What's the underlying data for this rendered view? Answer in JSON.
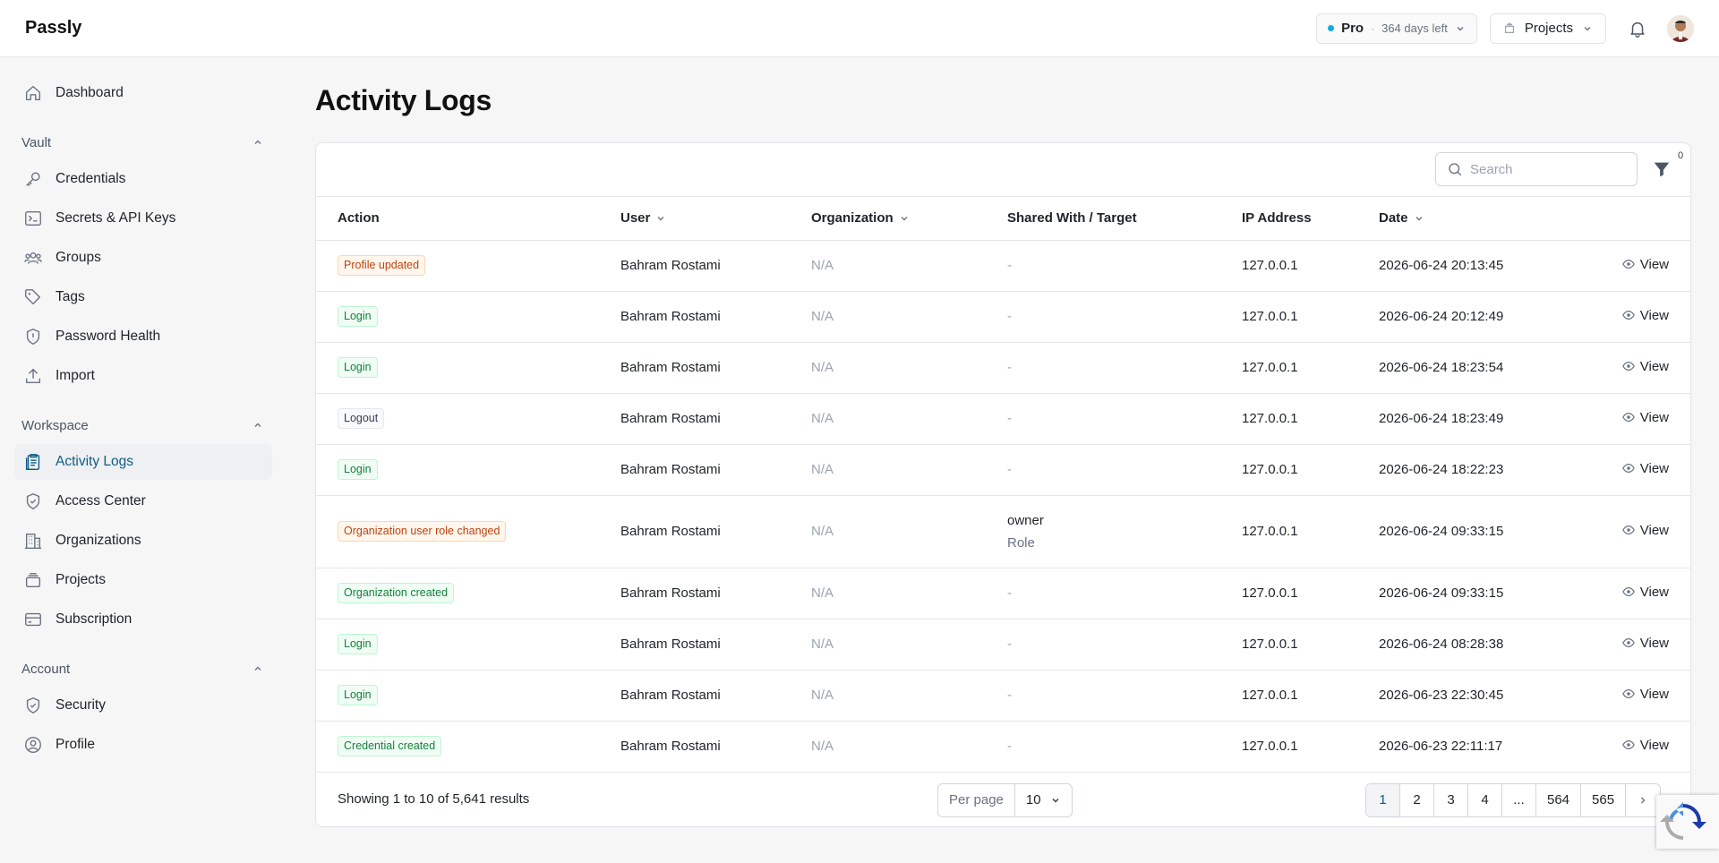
{
  "app": {
    "brand": "Passly"
  },
  "header": {
    "plan_name": "Pro",
    "plan_days": "364 days left",
    "projects_label": "Projects"
  },
  "sidebar": {
    "top_items": [
      {
        "label": "Dashboard",
        "icon": "home-icon"
      }
    ],
    "sections": [
      {
        "title": "Vault",
        "items": [
          {
            "label": "Credentials",
            "icon": "key-icon"
          },
          {
            "label": "Secrets & API Keys",
            "icon": "terminal-icon"
          },
          {
            "label": "Groups",
            "icon": "users-icon"
          },
          {
            "label": "Tags",
            "icon": "tag-icon"
          },
          {
            "label": "Password Health",
            "icon": "shield-alert-icon"
          },
          {
            "label": "Import",
            "icon": "upload-icon"
          }
        ]
      },
      {
        "title": "Workspace",
        "items": [
          {
            "label": "Activity Logs",
            "icon": "clipboard-icon"
          },
          {
            "label": "Access Center",
            "icon": "shield-check-icon"
          },
          {
            "label": "Organizations",
            "icon": "building-icon"
          },
          {
            "label": "Projects",
            "icon": "layers-icon"
          },
          {
            "label": "Subscription",
            "icon": "credit-card-icon"
          }
        ]
      },
      {
        "title": "Account",
        "items": [
          {
            "label": "Security",
            "icon": "shield-check-icon"
          },
          {
            "label": "Profile",
            "icon": "user-circle-icon"
          }
        ]
      }
    ]
  },
  "page": {
    "title": "Activity Logs"
  },
  "toolbar": {
    "search_placeholder": "Search",
    "filter_count": "0"
  },
  "table": {
    "columns": [
      "Action",
      "User",
      "Organization",
      "Shared With / Target",
      "IP Address",
      "Date"
    ],
    "view_label": "View",
    "rows": [
      {
        "action": "Profile updated",
        "tone": "orange",
        "user": "Bahram Rostami",
        "org": "N/A",
        "shared": "-",
        "shared_sub": "",
        "ip": "127.0.0.1",
        "date": "2026-06-24 20:13:45"
      },
      {
        "action": "Login",
        "tone": "green",
        "user": "Bahram Rostami",
        "org": "N/A",
        "shared": "-",
        "shared_sub": "",
        "ip": "127.0.0.1",
        "date": "2026-06-24 20:12:49"
      },
      {
        "action": "Login",
        "tone": "green",
        "user": "Bahram Rostami",
        "org": "N/A",
        "shared": "-",
        "shared_sub": "",
        "ip": "127.0.0.1",
        "date": "2026-06-24 18:23:54"
      },
      {
        "action": "Logout",
        "tone": "gray",
        "user": "Bahram Rostami",
        "org": "N/A",
        "shared": "-",
        "shared_sub": "",
        "ip": "127.0.0.1",
        "date": "2026-06-24 18:23:49"
      },
      {
        "action": "Login",
        "tone": "green",
        "user": "Bahram Rostami",
        "org": "N/A",
        "shared": "-",
        "shared_sub": "",
        "ip": "127.0.0.1",
        "date": "2026-06-24 18:22:23"
      },
      {
        "action": "Organization user role changed",
        "tone": "orange",
        "user": "Bahram Rostami",
        "org": "N/A",
        "shared": "owner",
        "shared_sub": "Role",
        "ip": "127.0.0.1",
        "date": "2026-06-24 09:33:15"
      },
      {
        "action": "Organization created",
        "tone": "green",
        "user": "Bahram Rostami",
        "org": "N/A",
        "shared": "-",
        "shared_sub": "",
        "ip": "127.0.0.1",
        "date": "2026-06-24 09:33:15"
      },
      {
        "action": "Login",
        "tone": "green",
        "user": "Bahram Rostami",
        "org": "N/A",
        "shared": "-",
        "shared_sub": "",
        "ip": "127.0.0.1",
        "date": "2026-06-24 08:28:38"
      },
      {
        "action": "Login",
        "tone": "green",
        "user": "Bahram Rostami",
        "org": "N/A",
        "shared": "-",
        "shared_sub": "",
        "ip": "127.0.0.1",
        "date": "2026-06-23 22:30:45"
      },
      {
        "action": "Credential created",
        "tone": "green",
        "user": "Bahram Rostami",
        "org": "N/A",
        "shared": "-",
        "shared_sub": "",
        "ip": "127.0.0.1",
        "date": "2026-06-23 22:11:17"
      }
    ]
  },
  "footer": {
    "results_text": "Showing 1 to 10 of 5,641 results",
    "per_page_label": "Per page",
    "per_page_value": "10",
    "pages": [
      "1",
      "2",
      "3",
      "4",
      "...",
      "564",
      "565"
    ],
    "current_page": "1"
  },
  "colors": {
    "accent": "#0e5c83",
    "status_dot": "#16a9e0"
  }
}
